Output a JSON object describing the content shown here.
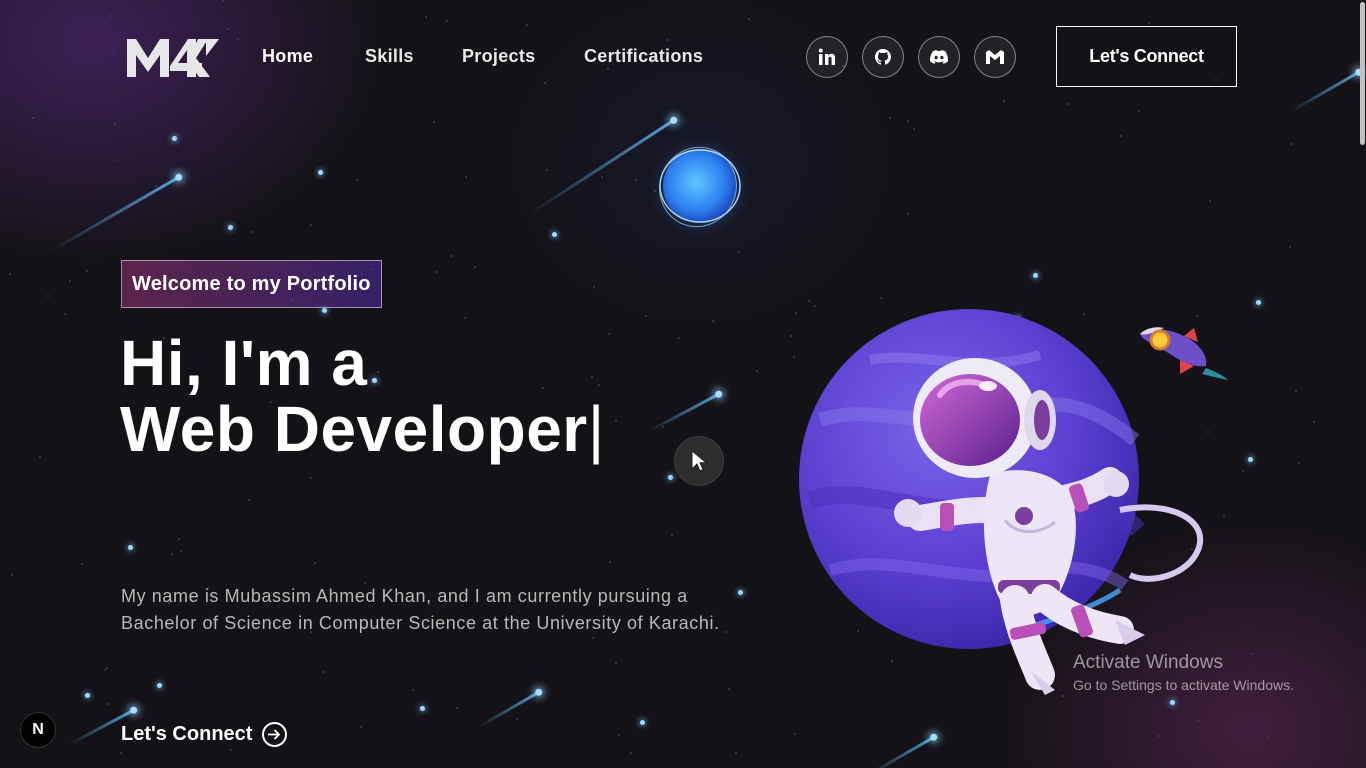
{
  "brand": {
    "logo_text": "M4K"
  },
  "nav": {
    "links": [
      "Home",
      "Skills",
      "Projects",
      "Certifications"
    ],
    "socials": [
      "linkedin-icon",
      "github-icon",
      "discord-icon",
      "gmail-icon"
    ],
    "connect_label": "Let's Connect"
  },
  "hero": {
    "tagline": "Welcome to my Portfolio",
    "headline_line1": "Hi, I'm a",
    "headline_line2": "Web Developer",
    "cursor": "|",
    "intro": "My name is Mubassim Ahmed Khan, and I am currently pursuing a Bachelor of Science in Computer Science at the University of Karachi.",
    "cta_label": "Let's Connect"
  },
  "overlay": {
    "next_badge": "N",
    "watermark_title": "Activate Windows",
    "watermark_sub": "Go to Settings to activate Windows."
  },
  "colors": {
    "background": "#121212",
    "accent_pink": "#AA367C",
    "accent_indigo": "#4A2FBD",
    "text_muted": "#B8B8B8"
  }
}
